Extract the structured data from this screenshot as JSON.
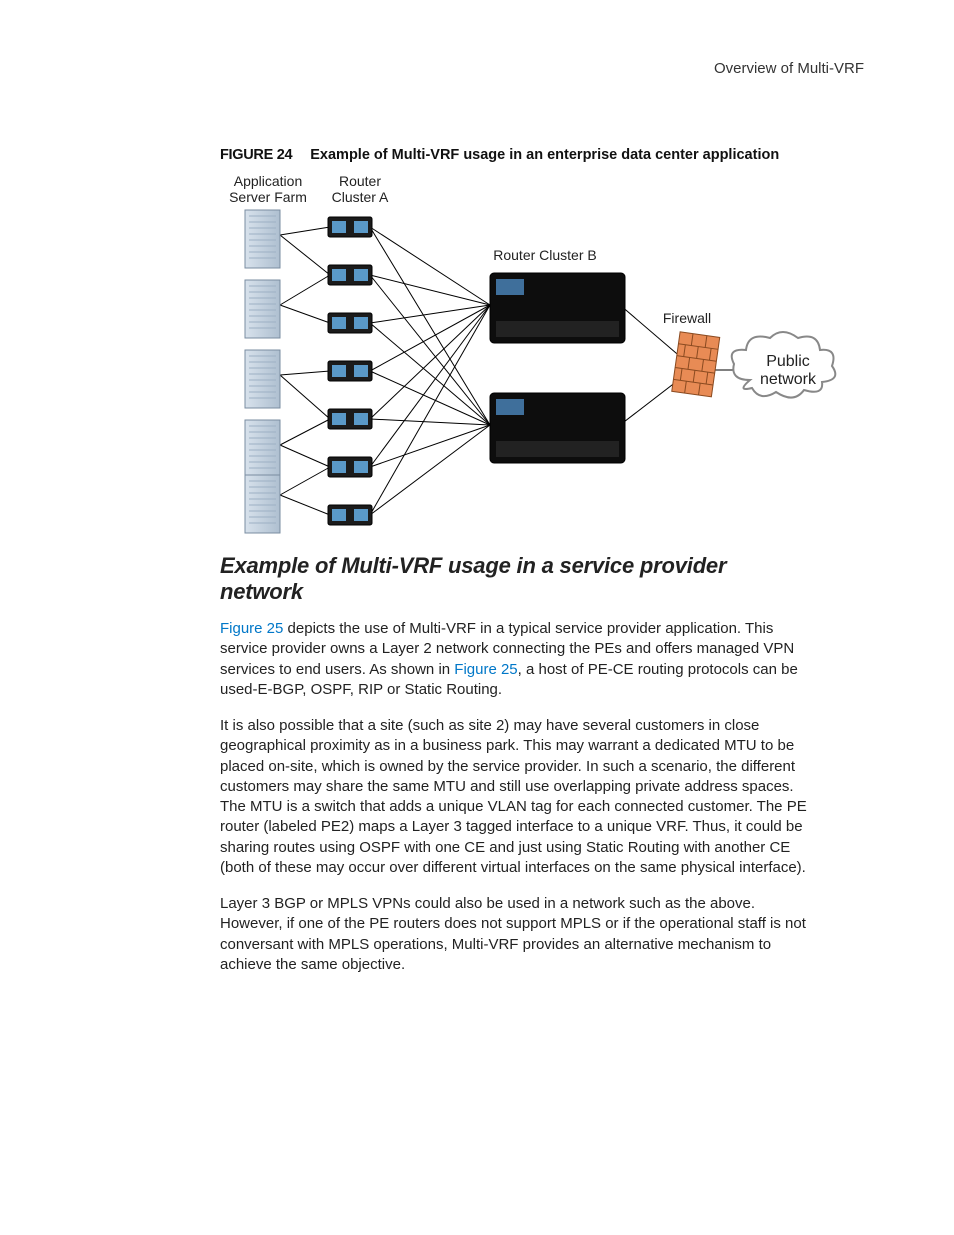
{
  "header": {
    "title": "Overview of Multi-VRF"
  },
  "figure": {
    "label": "FIGURE 24",
    "caption": "Example of Multi-VRF usage in an enterprise data center application",
    "labels": {
      "servers_l1": "Application",
      "servers_l2": "Server Farm",
      "clusterA_l1": "Router",
      "clusterA_l2": "Cluster A",
      "clusterB": "Router Cluster B",
      "firewall": "Firewall",
      "cloud_l1": "Public",
      "cloud_l2": "network"
    }
  },
  "section_heading": "Example of Multi-VRF usage in a service provider network",
  "para1": {
    "ref1": "Figure 25",
    "t1": " depicts the use of Multi-VRF in a typical service provider application. This service provider owns a Layer 2 network connecting the PEs and offers managed VPN services to end users. As shown in ",
    "ref2": "Figure 25",
    "t2": ", a host of PE-CE routing protocols can be used-E-BGP, OSPF, RIP or Static Routing."
  },
  "para2": "It is also possible that a site (such as site 2) may have several customers in close geographical proximity as in a business park. This may warrant a dedicated MTU to be placed on-site, which is owned by the service provider. In such a scenario, the different customers may share the same MTU and still use overlapping private address spaces. The MTU is a switch that adds a unique VLAN tag for each connected customer. The PE router (labeled PE2) maps a Layer 3 tagged interface to a unique VRF. Thus, it could be sharing routes using OSPF with one CE and just using Static Routing with another CE (both of these may occur over different virtual interfaces on the same physical interface).",
  "para3": "Layer 3 BGP or MPLS VPNs could also be used in a network such as the above. However, if one of the PE routers does not support MPLS or if the operational staff is not conversant with MPLS operations, Multi-VRF provides an alternative mechanism to achieve the same objective."
}
